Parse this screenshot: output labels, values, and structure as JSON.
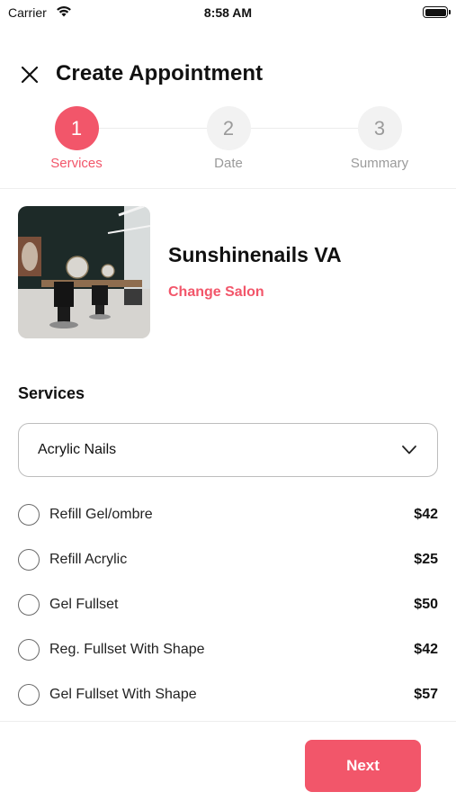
{
  "status_bar": {
    "carrier": "Carrier",
    "time": "8:58 AM",
    "icons": [
      "wifi-icon",
      "battery-icon"
    ]
  },
  "header": {
    "title": "Create Appointment",
    "close_icon": "close-icon"
  },
  "stepper": {
    "steps": [
      {
        "number": "1",
        "label": "Services",
        "active": true
      },
      {
        "number": "2",
        "label": "Date",
        "active": false
      },
      {
        "number": "3",
        "label": "Summary",
        "active": false
      }
    ]
  },
  "salon": {
    "name": "Sunshinenails VA",
    "change_label": "Change Salon"
  },
  "services": {
    "heading": "Services",
    "selected_category": "Acrylic Nails",
    "items": [
      {
        "name": "Refill Gel/ombre",
        "price": "$42",
        "selected": false
      },
      {
        "name": "Refill Acrylic",
        "price": "$25",
        "selected": false
      },
      {
        "name": "Gel Fullset",
        "price": "$50",
        "selected": false
      },
      {
        "name": "Reg. Fullset With Shape",
        "price": "$42",
        "selected": false
      },
      {
        "name": "Gel Fullset With Shape",
        "price": "$57",
        "selected": false
      }
    ]
  },
  "footer": {
    "next_label": "Next"
  },
  "colors": {
    "accent": "#f2566a",
    "inactive_step": "#f2f2f2",
    "inactive_text": "#9a9a9a",
    "border": "#bdbdbd"
  }
}
